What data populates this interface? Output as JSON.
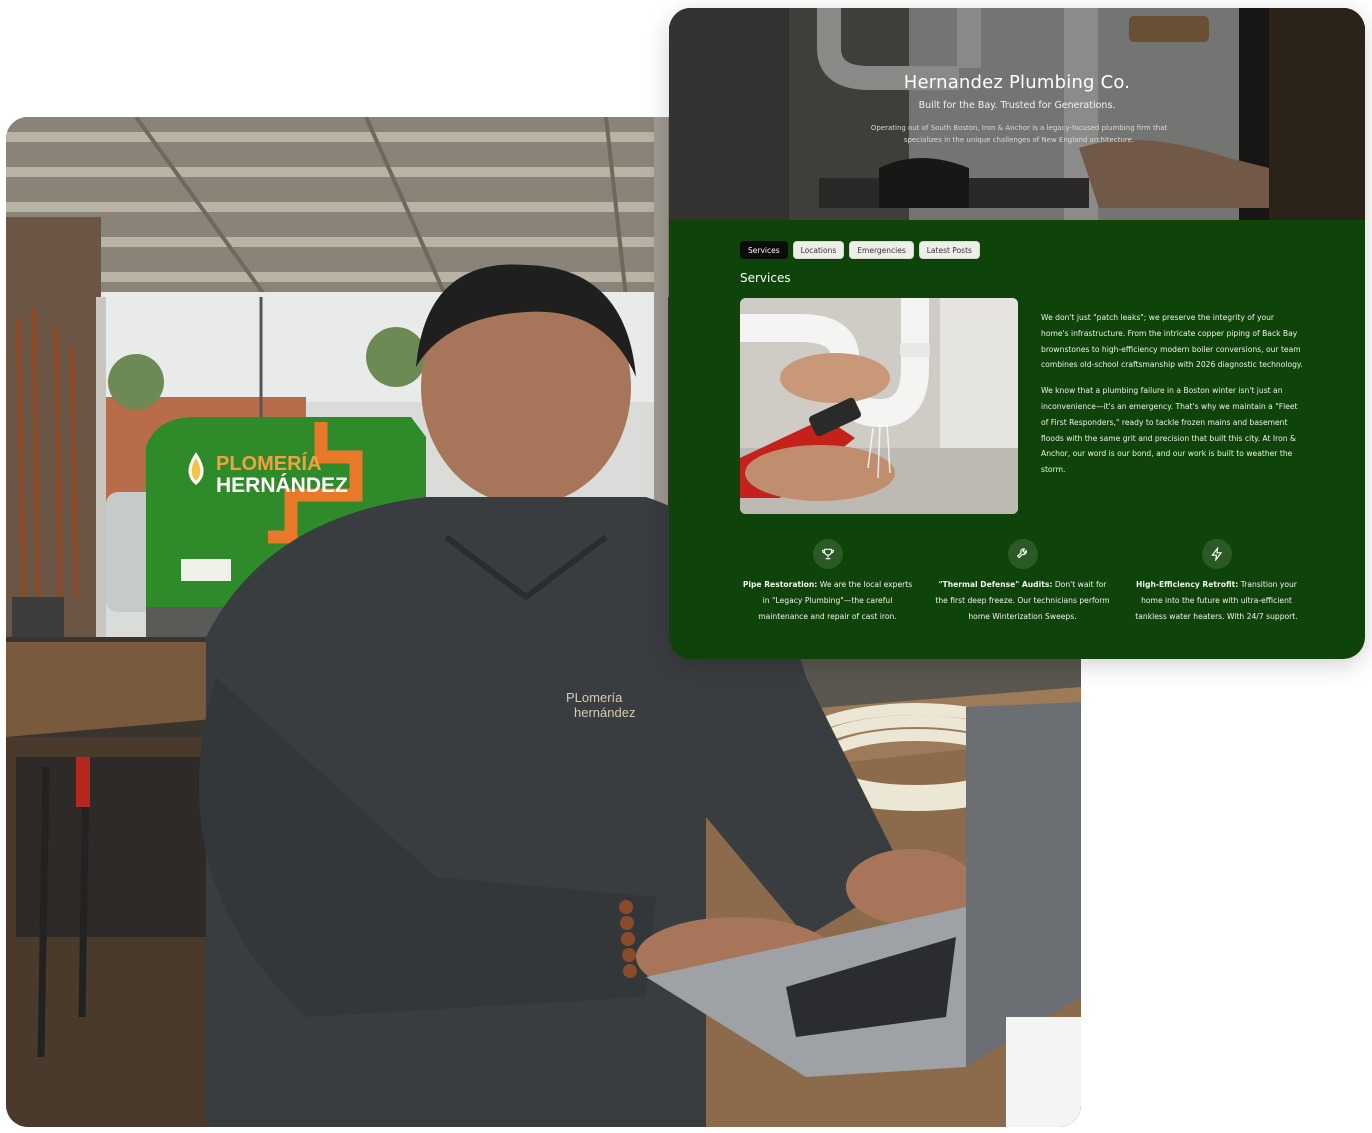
{
  "background_photo": {
    "van_text_line1": "PLOMERÍA",
    "van_text_line2": "HERNÁNDEZ",
    "shirt_logo_line1": "PLomería",
    "shirt_logo_line2": "hernández"
  },
  "website": {
    "hero": {
      "title": "Hernandez Plumbing Co.",
      "subtitle": "Built for the Bay. Trusted for Generations.",
      "description": "Operating out of South Boston, Iron & Anchor is a legacy-focused plumbing firm that specializes in the unique challenges of New England architecture."
    },
    "tabs": [
      {
        "label": "Services",
        "active": true
      },
      {
        "label": "Locations",
        "active": false
      },
      {
        "label": "Emergencies",
        "active": false
      },
      {
        "label": "Latest Posts",
        "active": false
      }
    ],
    "section_title": "Services",
    "paragraphs": [
      "We don't just \"patch leaks\"; we preserve the integrity of your home's infrastructure. From the intricate copper piping of Back Bay brownstones to high-efficiency modern boiler conversions, our team combines old-school craftsmanship with 2026 diagnostic technology.",
      "We know that a plumbing failure in a Boston winter isn't just an inconvenience—it's an emergency. That's why we maintain a \"Fleet of First Responders,\" ready to tackle frozen mains and basement floods with the same grit and precision that built this city. At Iron & Anchor, our word is our bond, and our work is built to weather the storm."
    ],
    "features": [
      {
        "icon": "trophy-icon",
        "title": "Pipe Restoration:",
        "text": "We are the local experts in \"Legacy Plumbing\"—the careful maintenance and repair of cast iron."
      },
      {
        "icon": "wrench-icon",
        "title": "\"Thermal Defense\" Audits:",
        "text": "Don't wait for the first deep freeze. Our technicians perform home Winterization Sweeps."
      },
      {
        "icon": "lightning-icon",
        "title": "High-Efficiency Retrofit:",
        "text": "Transition your home into the future with ultra-efficient tankless water heaters. With 24/7 support."
      }
    ]
  },
  "colors": {
    "panel_green": "#0e4309",
    "icon_circle": "#2b5a25",
    "tab_active": "#0b0b0b",
    "tab_inactive": "#efefe9",
    "van_green": "#2f8a2a",
    "van_orange": "#e8782a"
  }
}
